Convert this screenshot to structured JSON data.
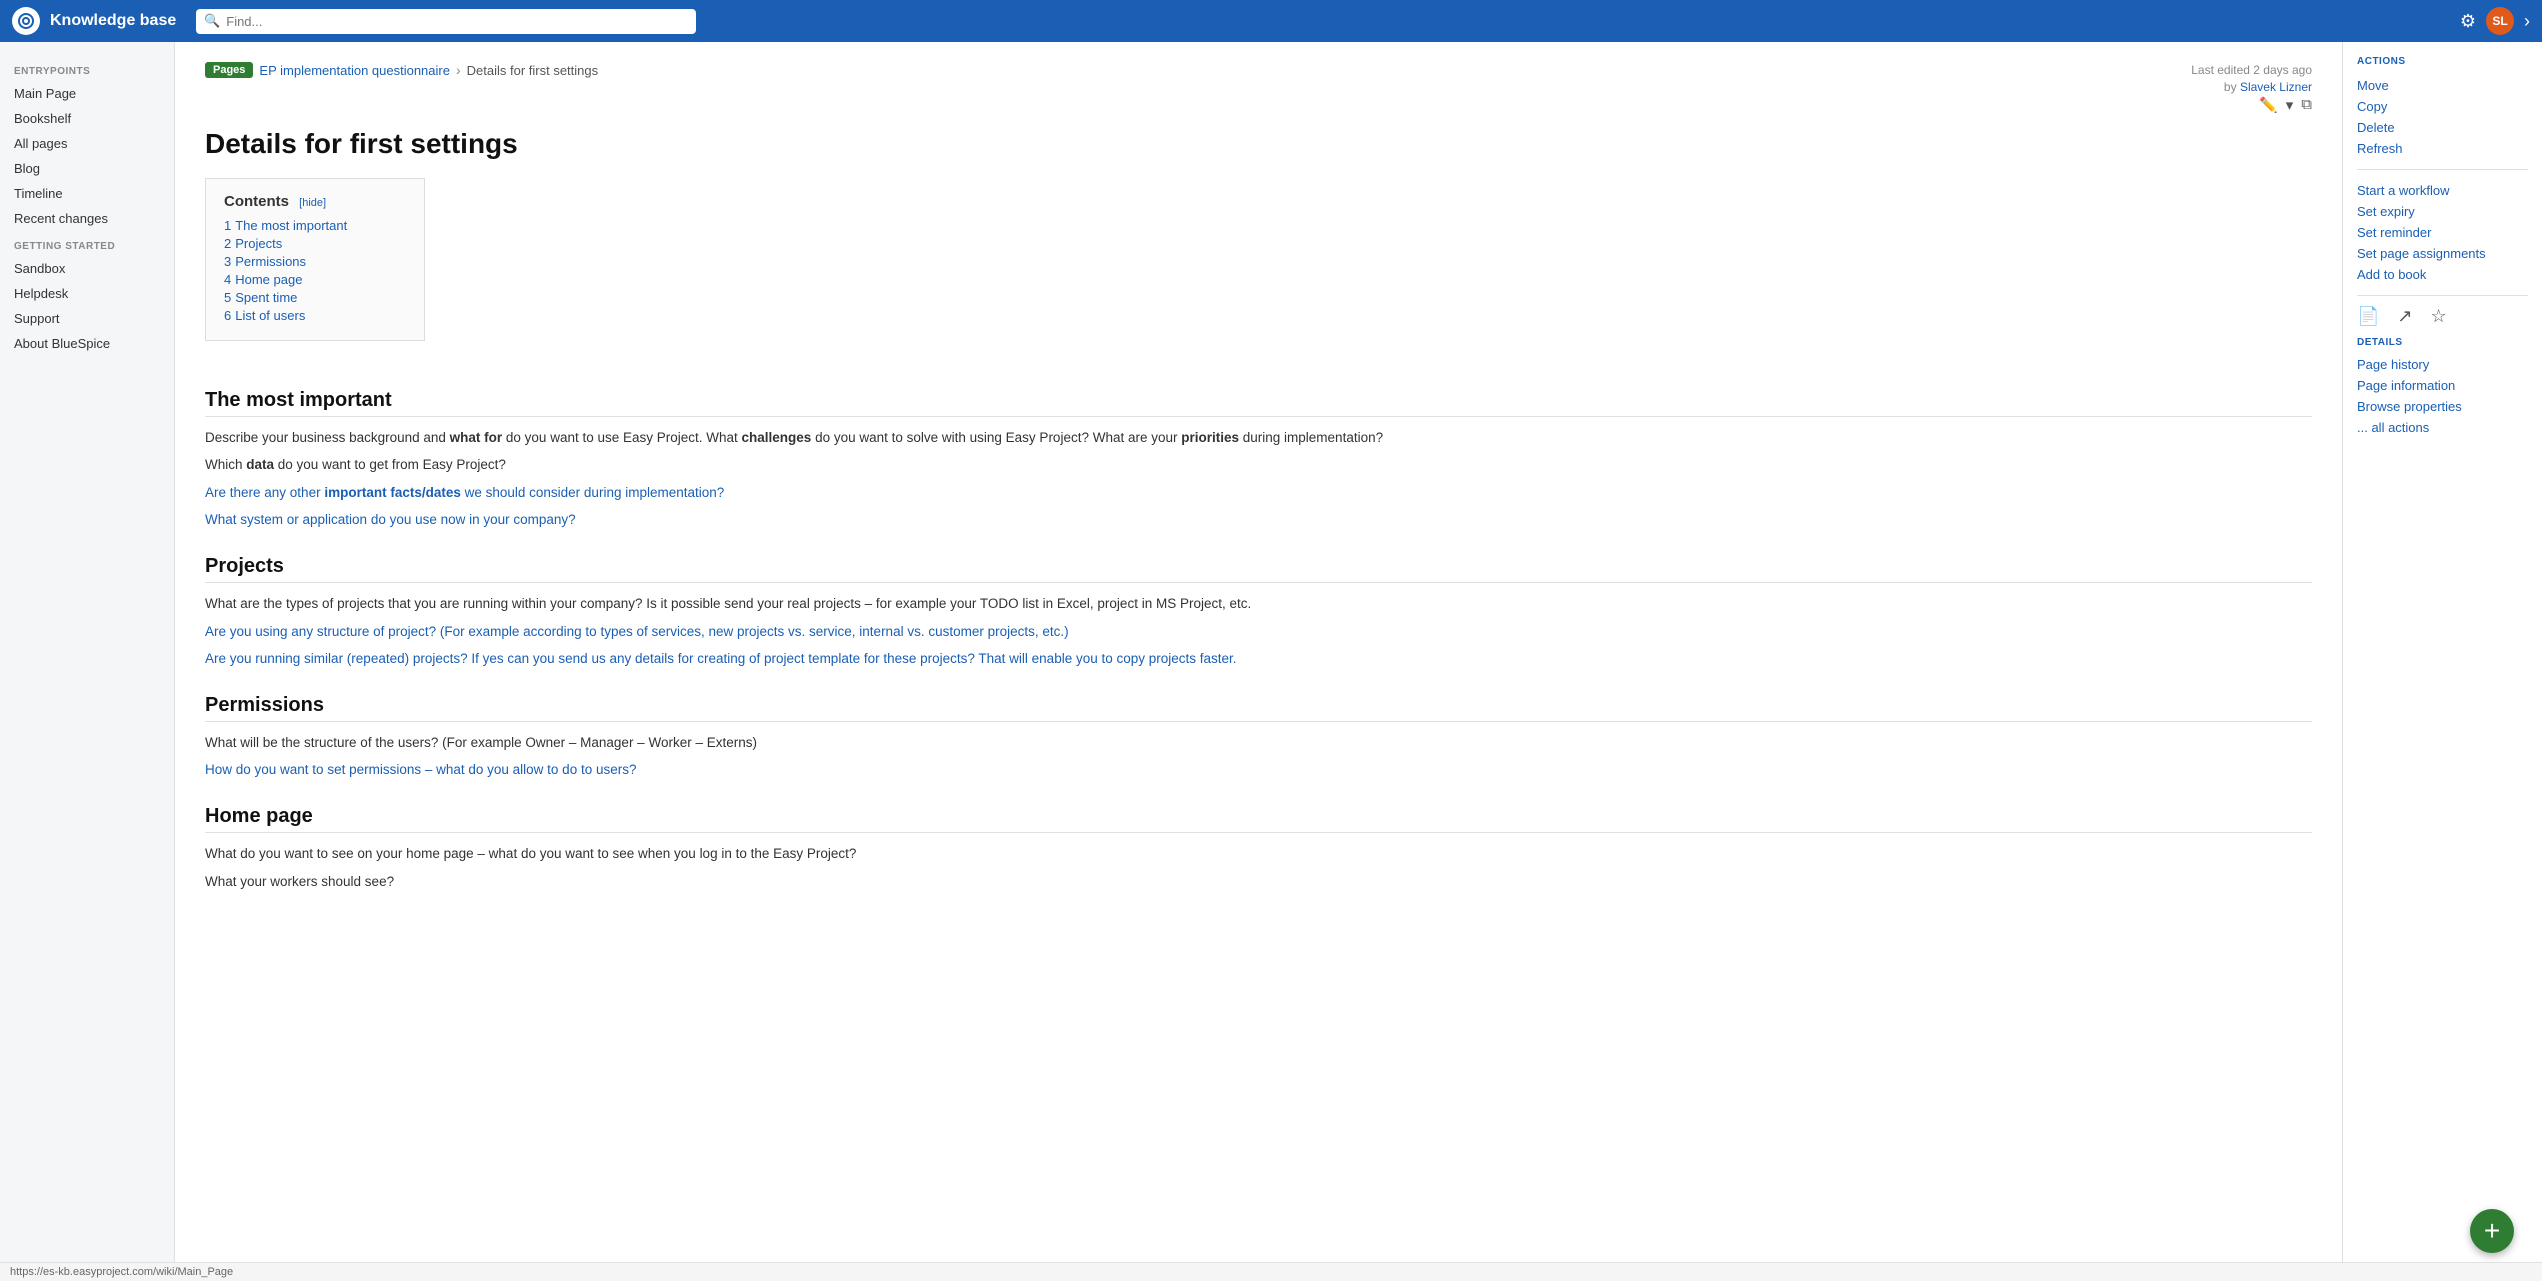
{
  "app": {
    "title": "Knowledge base",
    "logo_alt": "logo"
  },
  "search": {
    "placeholder": "Find..."
  },
  "topnav": {
    "avatar_initials": "SL",
    "settings_icon": "⚙",
    "chevron_icon": "›"
  },
  "sidebar": {
    "entry_points_label": "ENTRYPOINTS",
    "getting_started_label": "GETTING STARTED",
    "items_entry": [
      {
        "label": "Main Page"
      },
      {
        "label": "Bookshelf"
      },
      {
        "label": "All pages"
      },
      {
        "label": "Blog"
      },
      {
        "label": "Timeline"
      },
      {
        "label": "Recent changes"
      }
    ],
    "items_started": [
      {
        "label": "Sandbox"
      },
      {
        "label": "Helpdesk"
      },
      {
        "label": "Support"
      },
      {
        "label": "About BlueSpice"
      }
    ]
  },
  "breadcrumb": {
    "pages": "Pages",
    "parent": "EP implementation questionnaire",
    "current": "Details for first settings"
  },
  "meta": {
    "edited": "Last edited 2 days ago",
    "by": "by",
    "author": "Slavek Lizner"
  },
  "page": {
    "title": "Details for first settings",
    "contents_title": "Contents",
    "hide_label": "[hide]",
    "sections": [
      {
        "num": "1",
        "label": "The most important"
      },
      {
        "num": "2",
        "label": "Projects"
      },
      {
        "num": "3",
        "label": "Permissions"
      },
      {
        "num": "4",
        "label": "Home page"
      },
      {
        "num": "5",
        "label": "Spent time"
      },
      {
        "num": "6",
        "label": "List of users"
      }
    ]
  },
  "content": {
    "section1_title": "The most important",
    "section1_p1": "Describe your business background and what for do you want to use Easy Project. What challenges do you want to solve with using Easy Project? What are your priorities during implementation?",
    "section1_p2": "Which data do you want to get from Easy Project?",
    "section1_p3": "Are there any other important facts/dates we should consider during implementation?",
    "section1_p4": "What system or application do you use now in your company?",
    "section2_title": "Projects",
    "section2_p1": "What are the types of projects that you are running within your company? Is it possible send your real projects – for example your TODO list in Excel, project in MS Project, etc.",
    "section2_p2": "Are you using any structure of project? (For example according to types of services, new projects vs. service, internal vs. customer projects, etc.)",
    "section2_p3": "Are you running similar (repeated) projects? If yes can you send us any details for creating of project template for these projects? That will enable you to copy projects faster.",
    "section3_title": "Permissions",
    "section3_p1": "What will be the structure of the users? (For example Owner – Manager – Worker – Externs)",
    "section3_p2": "How do you want to set permissions – what do you allow to do to users?",
    "section4_title": "Home page",
    "section4_p1": "What do you want to see on your home page – what do you want to see when you log in to the Easy Project?",
    "section4_p2": "What your workers should see?"
  },
  "actions": {
    "label": "ACTIONS",
    "items": [
      {
        "label": "Move"
      },
      {
        "label": "Copy"
      },
      {
        "label": "Delete"
      },
      {
        "label": "Refresh"
      },
      {
        "label": "Start a workflow"
      },
      {
        "label": "Set expiry"
      },
      {
        "label": "Set reminder"
      },
      {
        "label": "Set page assignments"
      },
      {
        "label": "Add to book"
      }
    ]
  },
  "details": {
    "label": "DETAILS",
    "items": [
      {
        "label": "Page history"
      },
      {
        "label": "Page information"
      },
      {
        "label": "Browse properties"
      },
      {
        "label": "... all actions"
      }
    ]
  },
  "statusbar": {
    "url": "https://es-kb.easyproject.com/wiki/Main_Page"
  },
  "fab": {
    "icon": "+"
  }
}
